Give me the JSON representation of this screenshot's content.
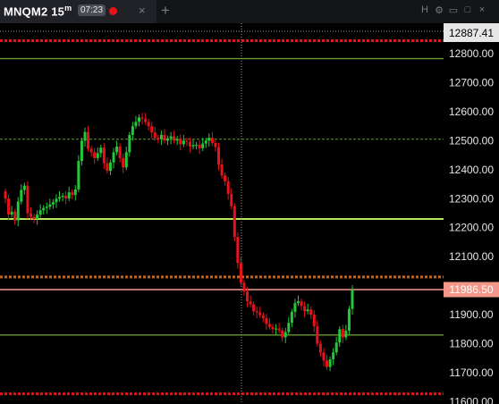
{
  "tab": {
    "symbol": "MNQM2",
    "timeframe": "15",
    "timeframe_unit": "m",
    "countdown": "07:23",
    "close_glyph": "×",
    "add_glyph": "+",
    "recording_color": "#e8121b"
  },
  "window_controls": [
    {
      "name": "help-icon",
      "glyph": "H"
    },
    {
      "name": "gear-icon",
      "glyph": "⚙"
    },
    {
      "name": "window-icon",
      "glyph": "▭"
    },
    {
      "name": "maximize-icon",
      "glyph": "□"
    },
    {
      "name": "close-window-icon",
      "glyph": "×"
    }
  ],
  "chart_data": {
    "type": "candlestick",
    "ylim": [
      11592,
      12905
    ],
    "y_ticks": [
      "12800.00",
      "12700.00",
      "12600.00",
      "12500.00",
      "12400.00",
      "12300.00",
      "12200.00",
      "12100.00",
      "11900.00",
      "11800.00",
      "11700.00",
      "11600.00"
    ],
    "current_price": "11986.50",
    "crosshair_price": "12887.41",
    "colors": {
      "up": "#22c93a",
      "down": "#e8121b",
      "axis_text": "#e6e6e6"
    },
    "levels": [
      {
        "price": 12845,
        "color": "#e8121b",
        "style": "dotted"
      },
      {
        "price": 12783,
        "color": "#6b9a2e",
        "style": "solid"
      },
      {
        "price": 12505,
        "color": "#6b9a2e",
        "style": "dashed"
      },
      {
        "price": 12230,
        "color": "#b2ea5a",
        "style": "solid"
      },
      {
        "price": 12030,
        "color": "#c8651a",
        "style": "dotted"
      },
      {
        "price": 11986.5,
        "color": "#f2988a",
        "style": "solid"
      },
      {
        "price": 11830,
        "color": "#6b9a2e",
        "style": "solid"
      },
      {
        "price": 11627,
        "color": "#e8121b",
        "style": "dotted"
      }
    ],
    "closes": [
      12300,
      12245,
      12255,
      12225,
      12290,
      12330,
      12345,
      12250,
      12238,
      12230,
      12245,
      12260,
      12268,
      12272,
      12280,
      12288,
      12300,
      12306,
      12310,
      12301,
      12322,
      12313,
      12332,
      12430,
      12500,
      12530,
      12472,
      12460,
      12440,
      12457,
      12476,
      12422,
      12396,
      12425,
      12460,
      12480,
      12440,
      12408,
      12460,
      12520,
      12550,
      12565,
      12580,
      12576,
      12565,
      12550,
      12528,
      12510,
      12505,
      12520,
      12500,
      12508,
      12515,
      12500,
      12506,
      12488,
      12500,
      12496,
      12480,
      12485,
      12486,
      12474,
      12490,
      12500,
      12510,
      12492,
      12478,
      12418,
      12380,
      12360,
      12316,
      12274,
      12168,
      12078,
      12010,
      11980,
      11946,
      11936,
      11912,
      11908,
      11898,
      11888,
      11868,
      11858,
      11850,
      11852,
      11846,
      11822,
      11840,
      11872,
      11910,
      11940,
      11946,
      11930,
      11912,
      11918,
      11900,
      11860,
      11800,
      11770,
      11742,
      11720,
      11746,
      11770,
      11804,
      11850,
      11822,
      11845,
      11920,
      11986.5
    ]
  }
}
